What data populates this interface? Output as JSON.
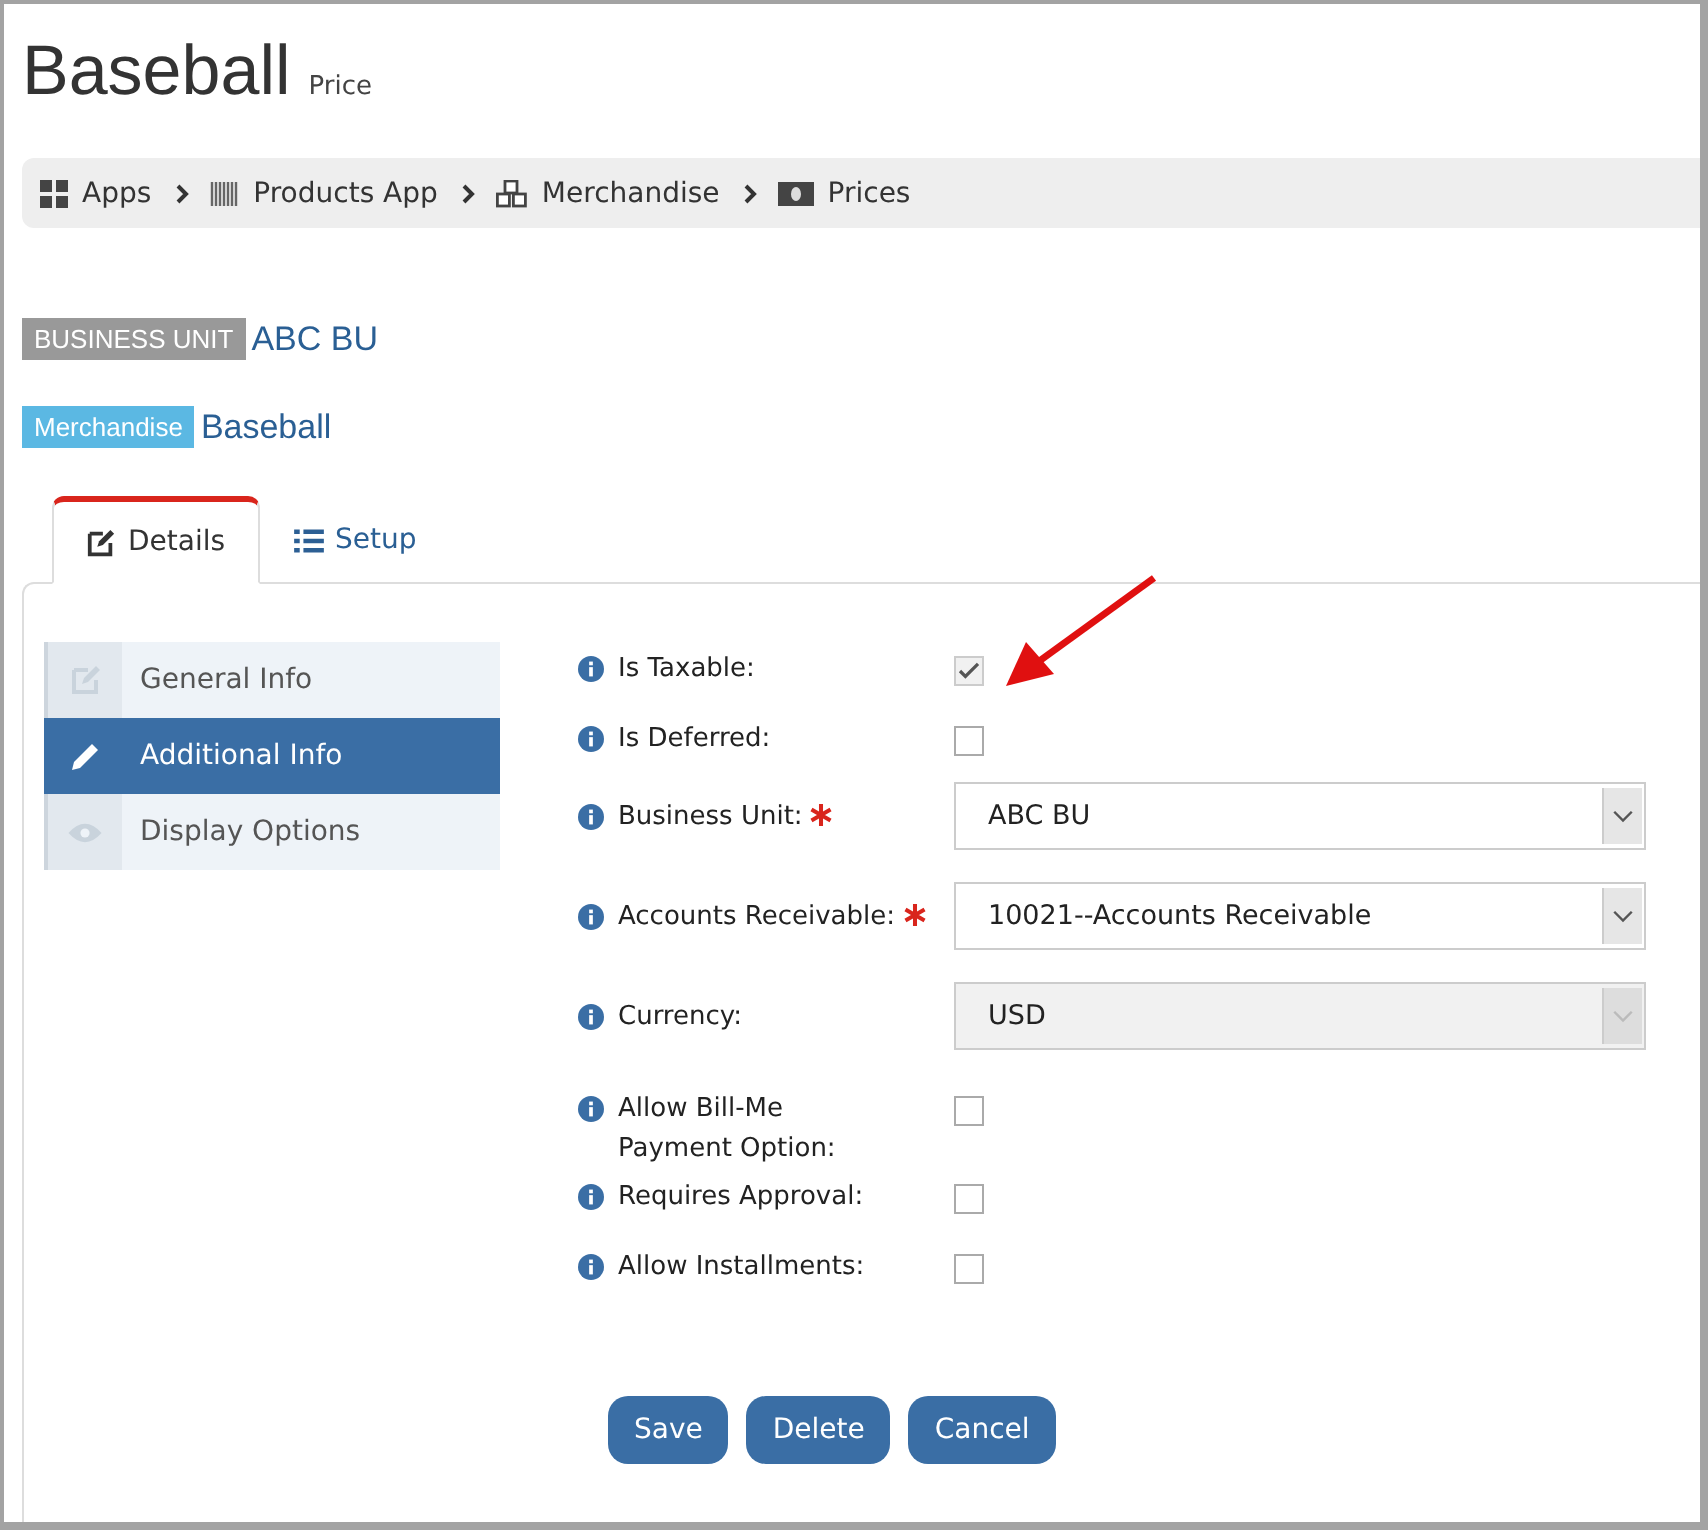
{
  "page": {
    "title": "Baseball",
    "subtitle": "Price"
  },
  "breadcrumb": [
    {
      "label": "Apps"
    },
    {
      "label": "Products App"
    },
    {
      "label": "Merchandise"
    },
    {
      "label": "Prices"
    }
  ],
  "context": [
    {
      "badge": "BUSINESS UNIT",
      "value": "ABC BU",
      "kind": "grey"
    },
    {
      "badge": "Merchandise",
      "value": "Baseball",
      "kind": "blue"
    }
  ],
  "tabs": [
    {
      "label": "Details",
      "selected": true
    },
    {
      "label": "Setup",
      "selected": false
    }
  ],
  "side_nav": [
    {
      "label": "General Info",
      "selected": false
    },
    {
      "label": "Additional Info",
      "selected": true
    },
    {
      "label": "Display Options",
      "selected": false
    }
  ],
  "fields": [
    {
      "kind": "checkbox",
      "label": "Is Taxable:",
      "required": false,
      "checked": true
    },
    {
      "kind": "checkbox",
      "label": "Is Deferred:",
      "required": false,
      "checked": false
    },
    {
      "kind": "select",
      "label": "Business Unit:",
      "required": true,
      "value": "ABC BU",
      "disabled": false
    },
    {
      "kind": "select",
      "label": "Accounts Receivable:",
      "required": true,
      "value": "10021--Accounts Receivable",
      "disabled": false
    },
    {
      "kind": "select",
      "label": "Currency:",
      "required": false,
      "value": "USD",
      "disabled": true
    },
    {
      "kind": "checkbox",
      "label": "Allow Bill-Me Payment Option:",
      "required": false,
      "checked": false
    },
    {
      "kind": "checkbox",
      "label": "Requires Approval:",
      "required": false,
      "checked": false
    },
    {
      "kind": "checkbox",
      "label": "Allow Installments:",
      "required": false,
      "checked": false
    }
  ],
  "buttons": [
    "Save",
    "Delete",
    "Cancel"
  ]
}
